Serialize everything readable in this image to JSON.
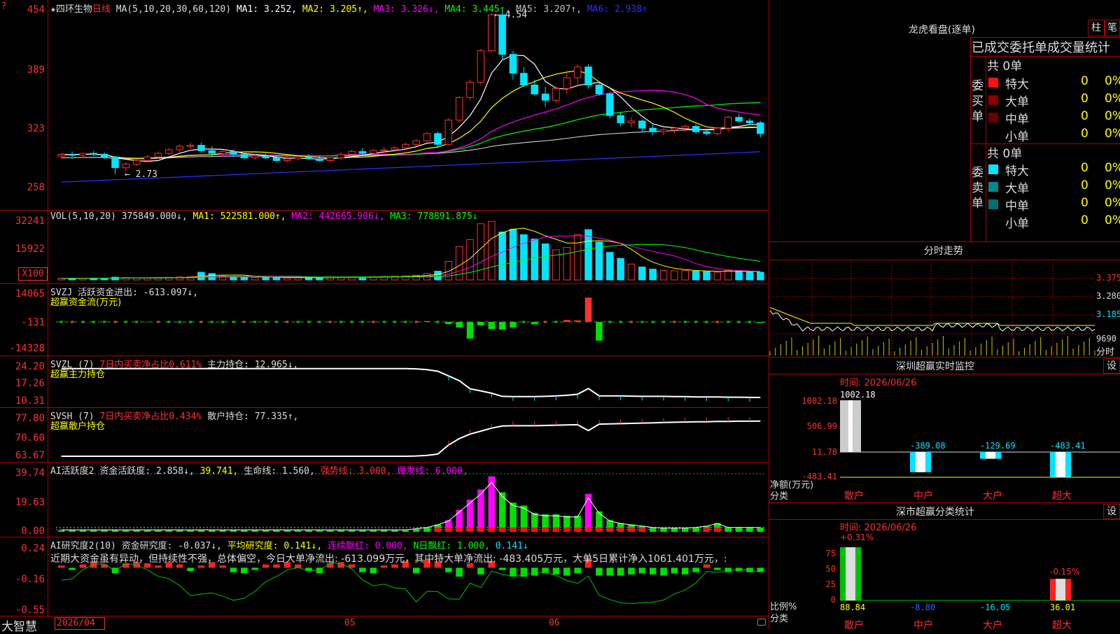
{
  "app": {
    "brand": "大智慧",
    "stock_name": "四环生物",
    "period_label": "日线",
    "corner_marker": "?"
  },
  "colors": {
    "up": "#ff3030",
    "down": "#00e5ff",
    "ma1": "#ffffff",
    "ma2": "#ffff00",
    "ma3": "#ff00ff",
    "ma4": "#00ff00",
    "ma5": "#c0c0c0",
    "ma6": "#3030ff",
    "grid": "#b00000",
    "label_red": "#ff3030"
  },
  "main_panel": {
    "legend_prefix": "★",
    "ma_def": "MA(5,10,20,30,60,120)",
    "ma_items": [
      {
        "label": "MA1: 3.252,",
        "color": "#ffffff"
      },
      {
        "label": "MA2: 3.205↑,",
        "color": "#ffff00"
      },
      {
        "label": "MA3: 3.326↓,",
        "color": "#ff00ff"
      },
      {
        "label": "MA4: 3.445↑,",
        "color": "#00ff00"
      },
      {
        "label": "MA5: 3.207↑,",
        "color": "#c0c0c0"
      },
      {
        "label": "MA6: 2.938↑",
        "color": "#3030ff"
      }
    ],
    "y_labels": [
      "454",
      "389",
      "323",
      "258"
    ],
    "high_label": "4.54",
    "low_label": "2.73"
  },
  "vol_panel": {
    "legend": [
      {
        "label": "VOL(5,10,20)",
        "color": "#dddddd"
      },
      {
        "label": "375849.000↓,",
        "color": "#dddddd"
      },
      {
        "label": "MA1: 522581.000↑,",
        "color": "#ffff00"
      },
      {
        "label": "MA2: 442665.906↓,",
        "color": "#ff00ff"
      },
      {
        "label": "MA3: 778891.875↓",
        "color": "#00ff00"
      }
    ],
    "y_labels": [
      "32241",
      "15922"
    ],
    "unit_label": "X100"
  },
  "svzj_panel": {
    "line1": [
      {
        "label": "SVZJ",
        "color": "#dddddd"
      },
      {
        "label": "活跃资金进出: -613.097↓,",
        "color": "#dddddd"
      }
    ],
    "line2": "超赢资金流(万元)",
    "y_labels": [
      "14065",
      "-131",
      "-14328"
    ]
  },
  "svzl_panel": {
    "line1": [
      {
        "label": "SVZL (7)",
        "color": "#dddddd"
      },
      {
        "label": "7日内买卖净占比0.611%",
        "color": "#ff3030"
      },
      {
        "label": "主力持仓: 12.965↓,",
        "color": "#dddddd"
      }
    ],
    "line2": "超赢主力持仓",
    "y_labels": [
      "24.20",
      "17.26",
      "10.31"
    ]
  },
  "svsh_panel": {
    "line1": [
      {
        "label": "SVSH (7)",
        "color": "#dddddd"
      },
      {
        "label": "7日内买卖净占比0.434%",
        "color": "#ff3030"
      },
      {
        "label": "散户持仓: 77.335↑,",
        "color": "#dddddd"
      }
    ],
    "line2": "超赢散户持仓",
    "y_labels": [
      "77.80",
      "70.60",
      "63.67"
    ]
  },
  "ai_active_panel": {
    "legend": [
      {
        "label": "AI活跃度2",
        "color": "#dddddd"
      },
      {
        "label": "资金活跃度: 2.858↓,",
        "color": "#dddddd"
      },
      {
        "label": "39.741,",
        "color": "#ffff00"
      },
      {
        "label": "生命线: 1.560,",
        "color": "#dddddd"
      },
      {
        "label": "强势线: 3.000,",
        "color": "#ff3030"
      },
      {
        "label": "爆发线: 6.000,",
        "color": "#ff00ff"
      }
    ],
    "y_labels": [
      "39.74",
      "19.63",
      "0.00"
    ]
  },
  "ai_research_panel": {
    "legend": [
      {
        "label": "AI研究度2(10)",
        "color": "#dddddd"
      },
      {
        "label": "资金研究度: -0.037↓,",
        "color": "#dddddd"
      },
      {
        "label": "平均研究度: 0.141↓,",
        "color": "#ffff00"
      },
      {
        "label": "连续飘红: 0.000,",
        "color": "#ff00ff"
      },
      {
        "label": "N日飘红: 1.000,",
        "color": "#00ff00"
      },
      {
        "label": "0.141↓",
        "color": "#00e5ff"
      }
    ],
    "commentary": "近期大资金虽有异动，但持续性不强，总体偏空，今日大单净流出: -613.099万元，其中特大单净流出: -483.405万元，大单5日累计净入1061.401万元，:",
    "y_labels": [
      "0.24",
      "-0.16",
      "-0.55"
    ]
  },
  "x_axis": {
    "labels": [
      "2026/04",
      "05",
      "06"
    ]
  },
  "right_panel": {
    "dragon_title": "龙虎看盘(逐单)",
    "btn_column": "柱",
    "btn_pen": "笔",
    "stats_title": "已成交委托单成交量统计",
    "buy_section": {
      "side_label": "委买单",
      "total": "共 0单",
      "rows": [
        {
          "name": "特大",
          "count": "0",
          "pct": "0%",
          "color": "#ff1010"
        },
        {
          "name": "大单",
          "count": "0",
          "pct": "0%",
          "color": "#8b0000"
        },
        {
          "name": "中单",
          "count": "0",
          "pct": "0%",
          "color": "#6a0000"
        },
        {
          "name": "小单",
          "count": "0",
          "pct": "0%",
          "color": "#000000"
        }
      ]
    },
    "sell_section": {
      "side_label": "委卖单",
      "total": "共 0单",
      "rows": [
        {
          "name": "特大",
          "count": "0",
          "pct": "0%",
          "color": "#00e5ff"
        },
        {
          "name": "大单",
          "count": "0",
          "pct": "0%",
          "color": "#008b8b"
        },
        {
          "name": "中单",
          "count": "0",
          "pct": "0%",
          "color": "#007070"
        },
        {
          "name": "小单",
          "count": "0",
          "pct": "0%",
          "color": "#000000"
        }
      ]
    },
    "intraday_title": "分时走势",
    "intraday_prices": [
      "3.375",
      "3.280",
      "3.185"
    ],
    "intraday_vol": "9690",
    "intraday_vol_unit": "分时",
    "sz_monitor": {
      "title": "深圳超赢实时监控",
      "set_btn": "设",
      "time_label": "时间: 2026/06/26",
      "y_labels": [
        "1002.18",
        "506.99",
        "11.78",
        "-483.41"
      ],
      "y_caption": "净额(万元)",
      "x_caption": "分类",
      "categories": [
        "散户",
        "中户",
        "大户",
        "超大"
      ],
      "values": [
        1002.18,
        -389.08,
        -129.69,
        -483.41
      ],
      "value_labels": [
        "1002.18",
        "-389.08",
        "-129.69",
        "-483.41"
      ]
    },
    "sz_class": {
      "title": "深市超赢分类统计",
      "set_btn": "设",
      "time_label": "时间: 2026/06/26",
      "y_labels": [
        "75",
        "50",
        "25",
        "0"
      ],
      "y_caption": "比例%",
      "x_caption": "分类",
      "categories": [
        "散户",
        "中户",
        "大户",
        "超大"
      ],
      "values": [
        88.84,
        -8.8,
        -16.05,
        36.01
      ],
      "value_labels": [
        "88.84",
        "-8.80",
        "-16.05",
        "36.01"
      ],
      "change_labels": [
        "+0.31%",
        "-0.15%"
      ]
    }
  },
  "chart_data": [
    {
      "type": "candlestick",
      "title": "四环生物 日线",
      "x_labels": [
        "2026/04",
        "05",
        "06"
      ],
      "ylim": [
        2.58,
        4.54
      ],
      "ohlc": [
        [
          2.93,
          2.96,
          2.9,
          2.95
        ],
        [
          2.95,
          2.98,
          2.92,
          2.94
        ],
        [
          2.94,
          2.97,
          2.91,
          2.96
        ],
        [
          2.96,
          2.99,
          2.93,
          2.95
        ],
        [
          2.95,
          2.97,
          2.9,
          2.92
        ],
        [
          2.92,
          2.93,
          2.73,
          2.8
        ],
        [
          2.8,
          2.86,
          2.76,
          2.84
        ],
        [
          2.84,
          2.9,
          2.82,
          2.88
        ],
        [
          2.88,
          2.94,
          2.86,
          2.92
        ],
        [
          2.92,
          2.98,
          2.9,
          2.96
        ],
        [
          2.96,
          3.02,
          2.94,
          3.0
        ],
        [
          3.0,
          3.06,
          2.97,
          3.04
        ],
        [
          3.04,
          3.08,
          3.01,
          3.05
        ],
        [
          3.05,
          3.08,
          2.97,
          2.99
        ],
        [
          2.99,
          3.04,
          2.92,
          2.96
        ],
        [
          2.96,
          3.0,
          2.92,
          2.98
        ],
        [
          2.98,
          3.0,
          2.93,
          2.95
        ],
        [
          2.95,
          2.96,
          2.89,
          2.91
        ],
        [
          2.91,
          2.95,
          2.89,
          2.93
        ],
        [
          2.93,
          2.96,
          2.9,
          2.91
        ],
        [
          2.91,
          2.93,
          2.86,
          2.88
        ],
        [
          2.88,
          2.92,
          2.86,
          2.9
        ],
        [
          2.9,
          2.94,
          2.88,
          2.92
        ],
        [
          2.92,
          2.95,
          2.89,
          2.9
        ],
        [
          2.9,
          2.93,
          2.87,
          2.88
        ],
        [
          2.88,
          2.92,
          2.86,
          2.91
        ],
        [
          2.91,
          2.97,
          2.89,
          2.95
        ],
        [
          2.95,
          3.0,
          2.93,
          2.98
        ],
        [
          2.98,
          3.02,
          2.94,
          2.96
        ],
        [
          2.96,
          3.01,
          2.94,
          2.99
        ],
        [
          2.99,
          3.03,
          2.96,
          3.0
        ],
        [
          3.0,
          3.04,
          2.98,
          3.02
        ],
        [
          3.02,
          3.08,
          3.0,
          3.06
        ],
        [
          3.06,
          3.12,
          3.04,
          3.1
        ],
        [
          3.1,
          3.2,
          3.08,
          3.18
        ],
        [
          3.18,
          3.2,
          3.02,
          3.06
        ],
        [
          3.06,
          3.35,
          3.05,
          3.33
        ],
        [
          3.33,
          3.6,
          3.3,
          3.58
        ],
        [
          3.58,
          3.78,
          3.55,
          3.75
        ],
        [
          3.75,
          4.12,
          3.72,
          4.1
        ],
        [
          4.1,
          4.52,
          4.08,
          4.5
        ],
        [
          4.5,
          4.54,
          4.0,
          4.06
        ],
        [
          4.06,
          4.1,
          3.78,
          3.85
        ],
        [
          3.85,
          3.92,
          3.7,
          3.72
        ],
        [
          3.72,
          3.78,
          3.6,
          3.62
        ],
        [
          3.62,
          3.7,
          3.48,
          3.55
        ],
        [
          3.55,
          3.7,
          3.52,
          3.68
        ],
        [
          3.68,
          3.85,
          3.62,
          3.8
        ],
        [
          3.8,
          3.95,
          3.7,
          3.92
        ],
        [
          3.92,
          3.95,
          3.68,
          3.72
        ],
        [
          3.72,
          3.76,
          3.6,
          3.62
        ],
        [
          3.62,
          3.64,
          3.35,
          3.38
        ],
        [
          3.38,
          3.42,
          3.26,
          3.3
        ],
        [
          3.3,
          3.36,
          3.25,
          3.32
        ],
        [
          3.32,
          3.34,
          3.2,
          3.24
        ],
        [
          3.24,
          3.28,
          3.16,
          3.2
        ],
        [
          3.2,
          3.24,
          3.16,
          3.22
        ],
        [
          3.22,
          3.26,
          3.18,
          3.24
        ],
        [
          3.24,
          3.28,
          3.2,
          3.26
        ],
        [
          3.26,
          3.28,
          3.18,
          3.2
        ],
        [
          3.2,
          3.22,
          3.16,
          3.18
        ],
        [
          3.18,
          3.26,
          3.16,
          3.24
        ],
        [
          3.24,
          3.38,
          3.2,
          3.36
        ],
        [
          3.36,
          3.4,
          3.3,
          3.32
        ],
        [
          3.32,
          3.35,
          3.28,
          3.3
        ],
        [
          3.3,
          3.32,
          3.14,
          3.18
        ]
      ]
    },
    {
      "type": "bar",
      "title": "VOL(5,10,20)",
      "ylim": [
        0,
        32241
      ],
      "values": [
        900,
        850,
        950,
        1000,
        900,
        1500,
        1300,
        1100,
        1000,
        1200,
        1400,
        1600,
        1800,
        4200,
        3500,
        2200,
        1800,
        1500,
        1400,
        1300,
        1200,
        1100,
        1200,
        1300,
        1100,
        1200,
        1400,
        1600,
        1500,
        1700,
        1900,
        2000,
        2200,
        2600,
        3500,
        4800,
        10200,
        18200,
        22100,
        30800,
        32100,
        26300,
        27800,
        24800,
        22400,
        19800,
        16500,
        17800,
        24900,
        27600,
        20800,
        15100,
        11800,
        8700,
        7100,
        5900,
        5200,
        5000,
        5100,
        4800,
        4500,
        4200,
        5200,
        4800,
        4400,
        4200
      ],
      "up_flags": [
        1,
        0,
        1,
        0,
        0,
        0,
        1,
        1,
        1,
        1,
        1,
        1,
        1,
        0,
        0,
        1,
        0,
        0,
        1,
        0,
        0,
        1,
        1,
        0,
        0,
        1,
        1,
        1,
        0,
        1,
        1,
        1,
        1,
        1,
        1,
        0,
        1,
        1,
        1,
        1,
        1,
        0,
        0,
        0,
        0,
        0,
        1,
        1,
        1,
        0,
        0,
        0,
        0,
        1,
        0,
        0,
        1,
        1,
        1,
        0,
        0,
        1,
        1,
        0,
        0,
        0
      ]
    },
    {
      "type": "bar",
      "title": "SVZJ 超赢资金流(万元)",
      "ylim": [
        -14328,
        14065
      ],
      "values": [
        0,
        0,
        0,
        0,
        0,
        0,
        0,
        0,
        -300,
        0,
        0,
        0,
        0,
        0,
        0,
        0,
        0,
        0,
        0,
        0,
        0,
        0,
        0,
        0,
        0,
        0,
        0,
        0,
        0,
        0,
        0,
        0,
        0,
        0,
        300,
        0,
        -1200,
        -2800,
        -8200,
        -1800,
        -3600,
        -3900,
        -2800,
        0,
        -1300,
        0,
        0,
        800,
        600,
        11600,
        -9200,
        0,
        0,
        0,
        0,
        0,
        0,
        0,
        0,
        0,
        0,
        0,
        0,
        0,
        0,
        -613
      ]
    },
    {
      "type": "line",
      "title": "SVZL 超赢主力持仓",
      "ylim": [
        10.31,
        24.2
      ],
      "values": [
        24.0,
        24.0,
        24.0,
        24.0,
        24.0,
        24.0,
        24.0,
        24.0,
        24.0,
        24.0,
        24.0,
        24.0,
        24.0,
        24.0,
        24.0,
        24.0,
        24.0,
        24.0,
        24.0,
        24.0,
        24.0,
        24.0,
        24.0,
        24.0,
        24.0,
        24.0,
        24.0,
        24.0,
        24.0,
        24.0,
        24.0,
        24.0,
        24.0,
        23.9,
        23.6,
        23.0,
        21.2,
        19.4,
        16.3,
        15.5,
        14.6,
        13.4,
        13.3,
        13.3,
        13.3,
        13.4,
        13.6,
        13.8,
        14.2,
        16.4,
        13.6,
        13.6,
        13.6,
        13.5,
        13.4,
        13.4,
        13.4,
        13.3,
        13.3,
        13.2,
        13.2,
        13.2,
        13.1,
        13.1,
        13.0,
        12.97
      ]
    },
    {
      "type": "line",
      "title": "SVSH 超赢散户持仓",
      "ylim": [
        63.67,
        77.8
      ],
      "values": [
        64.2,
        64.2,
        64.2,
        64.2,
        64.2,
        64.2,
        64.2,
        64.2,
        64.2,
        64.2,
        64.2,
        64.2,
        64.2,
        64.2,
        64.2,
        64.2,
        64.2,
        64.2,
        64.2,
        64.2,
        64.2,
        64.2,
        64.2,
        64.2,
        64.2,
        64.2,
        64.2,
        64.2,
        64.2,
        64.2,
        64.2,
        64.2,
        64.2,
        64.3,
        64.5,
        65.0,
        68.4,
        70.8,
        72.5,
        73.6,
        74.7,
        75.5,
        75.6,
        75.6,
        75.6,
        75.7,
        75.8,
        75.9,
        76.0,
        73.8,
        76.2,
        76.3,
        76.4,
        76.5,
        76.6,
        76.7,
        76.8,
        76.9,
        77.0,
        77.1,
        77.1,
        77.2,
        77.2,
        77.3,
        77.3,
        77.34
      ]
    },
    {
      "type": "bar",
      "title": "AI活跃度2",
      "ylim": [
        0,
        39.74
      ],
      "values": [
        1,
        1,
        1,
        1,
        1,
        1,
        1,
        1,
        1,
        1,
        1,
        1,
        1,
        1,
        1,
        1,
        1,
        1,
        1,
        1,
        1,
        1,
        1,
        1,
        1,
        1,
        1,
        1,
        1,
        1,
        1,
        1,
        1,
        2,
        3,
        5,
        8,
        15,
        22,
        29,
        38,
        27,
        20,
        18,
        13,
        12,
        12,
        11,
        11,
        26,
        14,
        8,
        6,
        5,
        4,
        3,
        2.5,
        2.5,
        2.5,
        3,
        4,
        6,
        3,
        3,
        2.9,
        2.86
      ],
      "burst_flags": [
        0,
        0,
        0,
        0,
        0,
        0,
        0,
        0,
        0,
        0,
        0,
        0,
        0,
        0,
        0,
        0,
        0,
        0,
        0,
        0,
        0,
        0,
        0,
        0,
        0,
        0,
        0,
        0,
        0,
        0,
        0,
        0,
        0,
        0,
        0,
        0,
        1,
        1,
        1,
        1,
        1,
        0,
        0,
        0,
        0,
        0,
        0,
        0,
        0,
        1,
        0,
        0,
        0,
        0,
        0,
        0,
        0,
        0,
        0,
        0,
        0,
        0,
        0,
        0,
        0,
        0
      ]
    },
    {
      "type": "bar",
      "title": "AI研究度2(10)",
      "ylim": [
        -0.55,
        0.24
      ],
      "values": [
        0.02,
        -0.02,
        0.03,
        0.05,
        0.03,
        -0.05,
        0.04,
        0.05,
        0.04,
        0.02,
        0.05,
        0.03,
        -0.03,
        0.02,
        0.05,
        0.02,
        -0.04,
        -0.05,
        -0.02,
        0.03,
        0.03,
        0.05,
        0.03,
        -0.03,
        -0.05,
        0.04,
        0.05,
        0.03,
        -0.04,
        -0.05,
        0.02,
        0.03,
        0.06,
        -0.05,
        0.07,
        0.06,
        -0.04,
        -0.08,
        0.04,
        -0.06,
        0.06,
        -0.02,
        -0.08,
        -0.08,
        -0.07,
        -0.05,
        -0.06,
        -0.07,
        -0.05,
        0.08,
        -0.07,
        -0.07,
        -0.07,
        -0.06,
        -0.05,
        -0.06,
        -0.07,
        -0.05,
        -0.06,
        -0.04,
        0.03,
        -0.02,
        -0.04,
        -0.03,
        -0.04,
        -0.037
      ]
    }
  ]
}
